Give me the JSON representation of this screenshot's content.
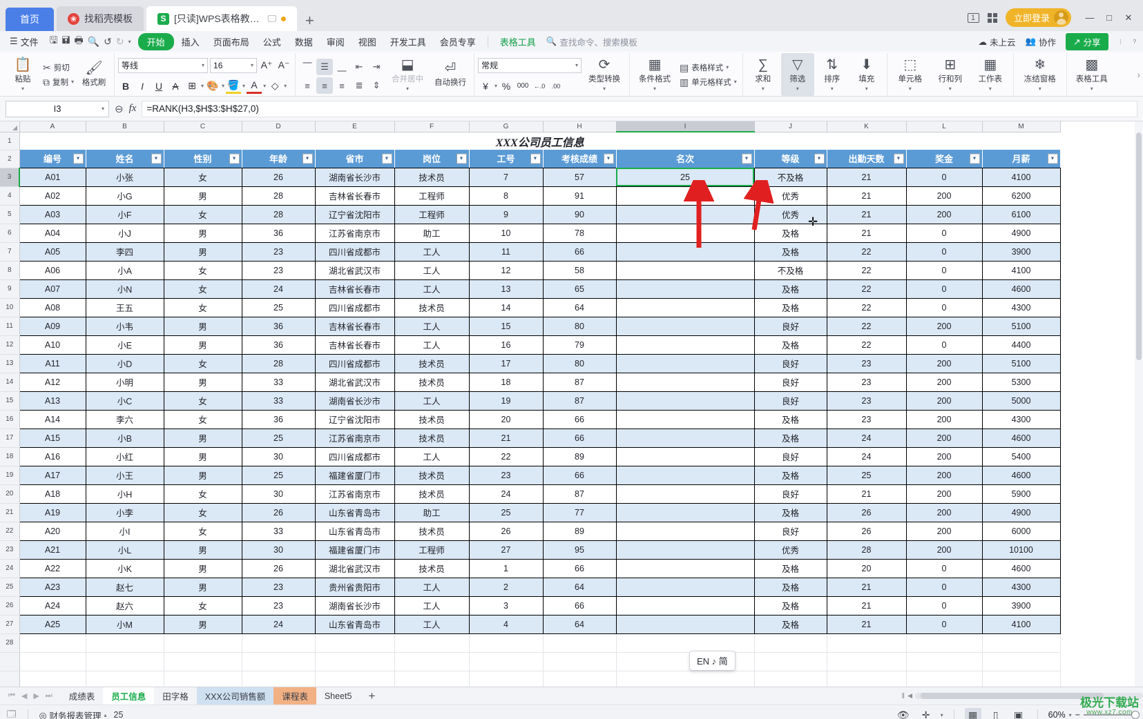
{
  "titlebar": {
    "home_tab": "首页",
    "tabs": [
      {
        "label": "找稻壳模板",
        "icon": "flower-icon",
        "active": false
      },
      {
        "label": "[只读]WPS表格教程.xlsx",
        "icon": "wps-sheet-icon",
        "active": true
      }
    ],
    "new_tab": "+",
    "page_count_badge": "1",
    "apps_icon": "apps-grid-icon",
    "login_label": "立即登录",
    "window_controls": {
      "minimize": "—",
      "maximize": "□",
      "close": "✕"
    }
  },
  "menubar": {
    "file_label": "文件",
    "quick_access": [
      "save-icon",
      "save-as-icon",
      "print-icon",
      "print-preview-icon",
      "undo-icon",
      "redo-icon",
      "customize-icon"
    ],
    "items": [
      {
        "label": "开始",
        "active": true
      },
      {
        "label": "插入",
        "active": false
      },
      {
        "label": "页面布局",
        "active": false
      },
      {
        "label": "公式",
        "active": false
      },
      {
        "label": "数据",
        "active": false
      },
      {
        "label": "审阅",
        "active": false
      },
      {
        "label": "视图",
        "active": false
      },
      {
        "label": "开发工具",
        "active": false
      },
      {
        "label": "会员专享",
        "active": false
      },
      {
        "label": "表格工具",
        "active": false,
        "tool": true
      }
    ],
    "search_placeholder": "查找命令、搜索模板",
    "cloud_status": "未上云",
    "collab_label": "协作",
    "share_label": "分享"
  },
  "ribbon": {
    "paste": "粘贴",
    "cut": "剪切",
    "copy": "复制",
    "format_painter": "格式刷",
    "font_name": "等线",
    "font_size": "16",
    "grow_font": "A⁺",
    "shrink_font": "A⁻",
    "bold": "B",
    "italic": "I",
    "underline": "U",
    "strikethrough": "A",
    "borders": "borders-icon",
    "effects": "text-effects-icon",
    "fill_color": "fill-color-icon",
    "font_color": "font-color-icon",
    "clear_format": "clear-format-icon",
    "merge_center": "合并居中",
    "wrap_text": "自动换行",
    "number_format": "常规",
    "currency": "¥",
    "percent": "%",
    "comma": "000",
    "dec_decrease": "←.0",
    "dec_increase": ".00",
    "type_convert": "类型转换",
    "conditional_format": "条件格式",
    "table_style": "表格样式",
    "cell_style": "单元格样式",
    "autosum": "求和",
    "filter": "筛选",
    "sort": "排序",
    "fill": "填充",
    "cells": "单元格",
    "rows_cols": "行和列",
    "worksheet": "工作表",
    "freeze_panes": "冻结窗格",
    "table_tools": "表格工具"
  },
  "formulabar": {
    "name_box": "I3",
    "fx_label": "fx",
    "formula": "=RANK(H3,$H$3:$H$27,0)"
  },
  "grid": {
    "column_letters": [
      "A",
      "B",
      "C",
      "D",
      "E",
      "F",
      "G",
      "H",
      "I",
      "J",
      "K",
      "L",
      "M"
    ],
    "selected_column": "I",
    "selected_row": 3,
    "sheet_title": "XXX公司员工信息",
    "headers": [
      "编号",
      "姓名",
      "性别",
      "年龄",
      "省市",
      "岗位",
      "工号",
      "考核成绩",
      "名次",
      "等级",
      "出勤天数",
      "奖金",
      "月薪"
    ],
    "rows": [
      [
        "A01",
        "小张",
        "女",
        "26",
        "湖南省长沙市",
        "技术员",
        "7",
        "57",
        "25",
        "不及格",
        "21",
        "0",
        "4100"
      ],
      [
        "A02",
        "小G",
        "男",
        "28",
        "吉林省长春市",
        "工程师",
        "8",
        "91",
        "",
        "优秀",
        "21",
        "200",
        "6200"
      ],
      [
        "A03",
        "小F",
        "女",
        "28",
        "辽宁省沈阳市",
        "工程师",
        "9",
        "90",
        "",
        "优秀",
        "21",
        "200",
        "6100"
      ],
      [
        "A04",
        "小J",
        "男",
        "36",
        "江苏省南京市",
        "助工",
        "10",
        "78",
        "",
        "及格",
        "21",
        "0",
        "4900"
      ],
      [
        "A05",
        "李四",
        "男",
        "23",
        "四川省成都市",
        "工人",
        "11",
        "66",
        "",
        "及格",
        "22",
        "0",
        "3900"
      ],
      [
        "A06",
        "小A",
        "女",
        "23",
        "湖北省武汉市",
        "工人",
        "12",
        "58",
        "",
        "不及格",
        "22",
        "0",
        "4100"
      ],
      [
        "A07",
        "小N",
        "女",
        "24",
        "吉林省长春市",
        "工人",
        "13",
        "65",
        "",
        "及格",
        "22",
        "0",
        "4600"
      ],
      [
        "A08",
        "王五",
        "女",
        "25",
        "四川省成都市",
        "技术员",
        "14",
        "64",
        "",
        "及格",
        "22",
        "0",
        "4300"
      ],
      [
        "A09",
        "小韦",
        "男",
        "36",
        "吉林省长春市",
        "工人",
        "15",
        "80",
        "",
        "良好",
        "22",
        "200",
        "5100"
      ],
      [
        "A10",
        "小E",
        "男",
        "36",
        "吉林省长春市",
        "工人",
        "16",
        "79",
        "",
        "及格",
        "22",
        "0",
        "4400"
      ],
      [
        "A11",
        "小D",
        "女",
        "28",
        "四川省成都市",
        "技术员",
        "17",
        "80",
        "",
        "良好",
        "23",
        "200",
        "5100"
      ],
      [
        "A12",
        "小明",
        "男",
        "33",
        "湖北省武汉市",
        "技术员",
        "18",
        "87",
        "",
        "良好",
        "23",
        "200",
        "5300"
      ],
      [
        "A13",
        "小C",
        "女",
        "33",
        "湖南省长沙市",
        "工人",
        "19",
        "87",
        "",
        "良好",
        "23",
        "200",
        "5000"
      ],
      [
        "A14",
        "李六",
        "女",
        "36",
        "辽宁省沈阳市",
        "技术员",
        "20",
        "66",
        "",
        "及格",
        "23",
        "200",
        "4300"
      ],
      [
        "A15",
        "小B",
        "男",
        "25",
        "江苏省南京市",
        "技术员",
        "21",
        "66",
        "",
        "及格",
        "24",
        "200",
        "4600"
      ],
      [
        "A16",
        "小红",
        "男",
        "30",
        "四川省成都市",
        "工人",
        "22",
        "89",
        "",
        "良好",
        "24",
        "200",
        "5400"
      ],
      [
        "A17",
        "小王",
        "男",
        "25",
        "福建省厦门市",
        "技术员",
        "23",
        "66",
        "",
        "及格",
        "25",
        "200",
        "4600"
      ],
      [
        "A18",
        "小H",
        "女",
        "30",
        "江苏省南京市",
        "技术员",
        "24",
        "87",
        "",
        "良好",
        "21",
        "200",
        "5900"
      ],
      [
        "A19",
        "小李",
        "女",
        "26",
        "山东省青岛市",
        "助工",
        "25",
        "77",
        "",
        "及格",
        "26",
        "200",
        "4900"
      ],
      [
        "A20",
        "小I",
        "女",
        "33",
        "山东省青岛市",
        "技术员",
        "26",
        "89",
        "",
        "良好",
        "26",
        "200",
        "6000"
      ],
      [
        "A21",
        "小L",
        "男",
        "30",
        "福建省厦门市",
        "工程师",
        "27",
        "95",
        "",
        "优秀",
        "28",
        "200",
        "10100"
      ],
      [
        "A22",
        "小K",
        "男",
        "26",
        "湖北省武汉市",
        "技术员",
        "1",
        "66",
        "",
        "及格",
        "20",
        "0",
        "4600"
      ],
      [
        "A23",
        "赵七",
        "男",
        "23",
        "贵州省贵阳市",
        "工人",
        "2",
        "64",
        "",
        "及格",
        "21",
        "0",
        "4300"
      ],
      [
        "A24",
        "赵六",
        "女",
        "23",
        "湖南省长沙市",
        "工人",
        "3",
        "66",
        "",
        "及格",
        "21",
        "0",
        "3900"
      ],
      [
        "A25",
        "小M",
        "男",
        "24",
        "山东省青岛市",
        "工人",
        "4",
        "64",
        "",
        "及格",
        "21",
        "0",
        "4100"
      ]
    ],
    "row_numbers": [
      "1",
      "2",
      "3",
      "4",
      "5",
      "6",
      "7",
      "8",
      "9",
      "10",
      "11",
      "12",
      "13",
      "14",
      "15",
      "16",
      "17",
      "18",
      "19",
      "20",
      "21",
      "22",
      "23",
      "24",
      "25",
      "26",
      "27",
      "28"
    ],
    "header_bg": "#5b9bd5",
    "band_bg": "#dbe8f5",
    "selection_color": "#1aac4b",
    "annotation_arrow_color": "#e02020"
  },
  "sheetbar": {
    "nav": [
      "⏮",
      "◀",
      "▶",
      "⏭"
    ],
    "tabs": [
      {
        "label": "成绩表",
        "style": "plain"
      },
      {
        "label": "员工信息",
        "style": "active"
      },
      {
        "label": "田字格",
        "style": "plain"
      },
      {
        "label": "XXX公司销售额",
        "style": "blue"
      },
      {
        "label": "课程表",
        "style": "orange"
      },
      {
        "label": "Sheet5",
        "style": "plain"
      }
    ],
    "add_sheet": "+"
  },
  "statusbar": {
    "js_icon": "js-macro-icon",
    "report_label": "财务报表管理",
    "count_value": "25",
    "eye_icon": "eye-icon",
    "center_icon": "center-mark-icon",
    "view_buttons": [
      "normal-view-icon",
      "page-layout-icon",
      "page-break-icon"
    ],
    "zoom_level": "60%",
    "zoom_minus": "−"
  },
  "ime_tip": "EN ♪ 简",
  "watermark": {
    "title": "极光下载站",
    "sub": "www.xz7.com"
  }
}
